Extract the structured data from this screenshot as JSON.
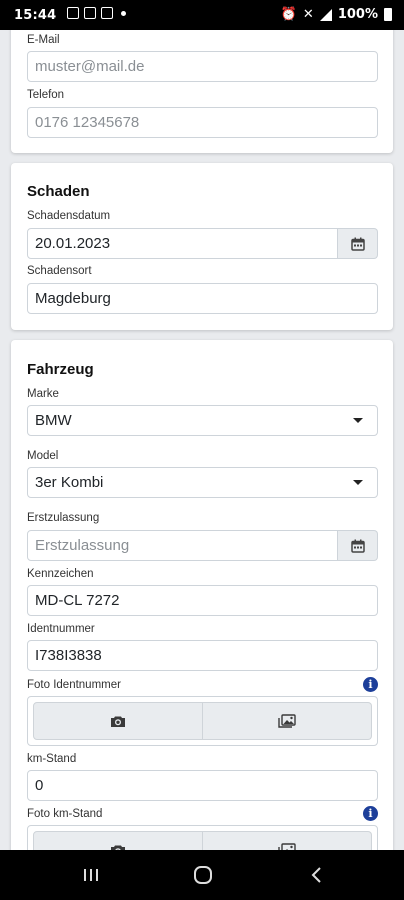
{
  "statusbar": {
    "time": "15:44",
    "battery": "100%"
  },
  "contact": {
    "email_label": "E-Mail",
    "email_placeholder": "muster@mail.de",
    "phone_label": "Telefon",
    "phone_placeholder": "0176 12345678"
  },
  "damage": {
    "heading": "Schaden",
    "date_label": "Schadensdatum",
    "date_value": "20.01.2023",
    "place_label": "Schadensort",
    "place_value": "Magdeburg"
  },
  "vehicle": {
    "heading": "Fahrzeug",
    "brand_label": "Marke",
    "brand_value": "BMW",
    "model_label": "Model",
    "model_value": "3er Kombi",
    "registration_label": "Erstzulassung",
    "registration_placeholder": "Erstzulassung",
    "plate_label": "Kennzeichen",
    "plate_value": "MD-CL 7272",
    "vin_label": "Identnummer",
    "vin_value": "I738I3838",
    "vin_photo_label": "Foto Identnummer",
    "km_label": "km-Stand",
    "km_value": "0",
    "km_photo_label": "Foto km-Stand"
  },
  "icons": {
    "calendar": "calendar-icon",
    "camera": "camera-icon",
    "gallery": "gallery-icon",
    "info": "info-icon",
    "dropdown": "chevron-down-icon"
  },
  "colors": {
    "info_accent": "#1d3f9a",
    "input_border": "#ced4da",
    "button_bg": "#e9ecef"
  }
}
